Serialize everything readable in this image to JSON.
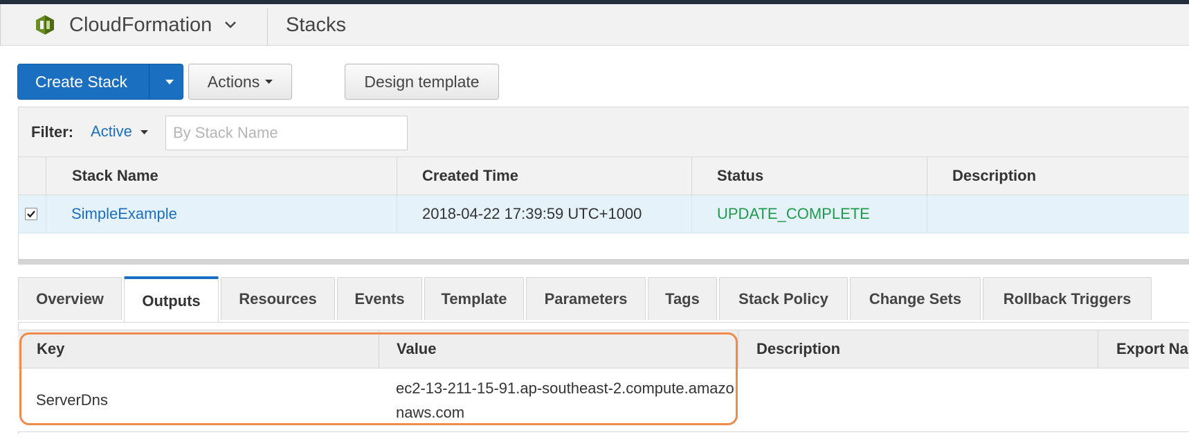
{
  "colors": {
    "primary": "#1a6fc0",
    "status_complete": "#1d9b4a",
    "highlight_outline": "#ef8a4b",
    "logo_green": "#6b8e23"
  },
  "header": {
    "service_name": "CloudFormation",
    "page_title": "Stacks",
    "logo_icon": "cloudformation-logo-icon",
    "chevron_icon": "chevron-down-icon"
  },
  "toolbar": {
    "create_stack_label": "Create Stack",
    "actions_label": "Actions",
    "design_template_label": "Design template"
  },
  "filter": {
    "label": "Filter:",
    "mode": "Active",
    "placeholder": "By Stack Name",
    "value": ""
  },
  "stacks_table": {
    "columns": [
      "Stack Name",
      "Created Time",
      "Status",
      "Description"
    ],
    "rows": [
      {
        "selected": true,
        "name": "SimpleExample",
        "created": "2018-04-22 17:39:59 UTC+1000",
        "status": "UPDATE_COMPLETE",
        "description": ""
      }
    ]
  },
  "detail_tabs": {
    "active": "Outputs",
    "items": [
      "Overview",
      "Outputs",
      "Resources",
      "Events",
      "Template",
      "Parameters",
      "Tags",
      "Stack Policy",
      "Change Sets",
      "Rollback Triggers"
    ]
  },
  "outputs_table": {
    "columns": [
      "Key",
      "Value",
      "Description",
      "Export Na"
    ],
    "rows": [
      {
        "key": "ServerDns",
        "value": "ec2-13-211-15-91.ap-southeast-2.compute.amazonaws.com",
        "description": "",
        "export_name": ""
      }
    ]
  }
}
